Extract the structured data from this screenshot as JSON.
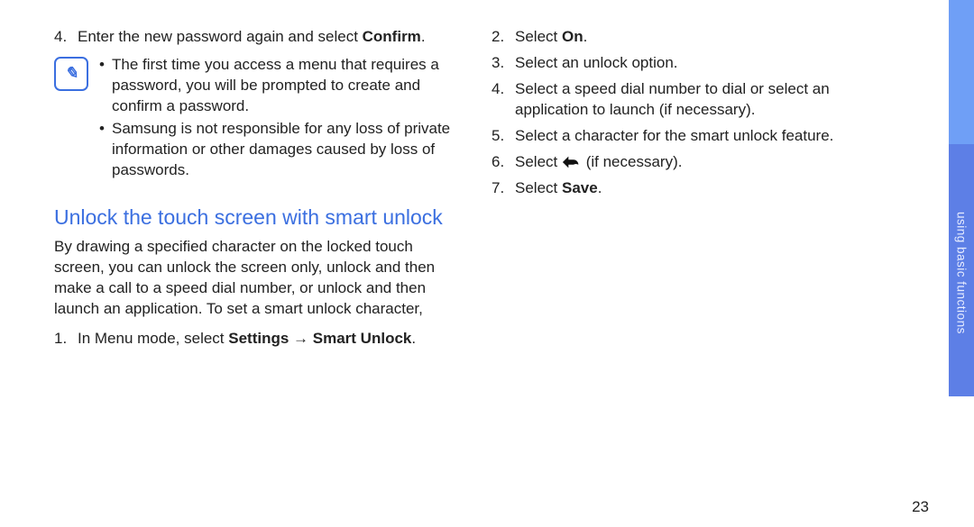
{
  "leftColumn": {
    "step4_pre": "Enter the new password again and select ",
    "step4_bold": "Confirm",
    "step4_post": ".",
    "note_icon_text": "✎",
    "note_b1": "The first time you access a menu that requires a password, you will be prompted to create and confirm a password.",
    "note_b2": "Samsung is not responsible for any loss of private information or other damages caused by loss of passwords.",
    "heading": "Unlock the touch screen with smart unlock",
    "intro": "By drawing a specified character on the locked touch screen, you can unlock the screen only, unlock and then make a call to a speed dial number, or unlock and then launch an application. To set a smart unlock character,",
    "step1_pre": "In Menu mode, select ",
    "step1_bold": "Settings → Smart Unlock",
    "step1_post": "."
  },
  "rightColumn": {
    "step2_pre": "Select ",
    "step2_bold": "On",
    "step2_post": ".",
    "step3": "Select an unlock option.",
    "step4": "Select a speed dial number to dial or select an application to launch (if necessary).",
    "step5": "Select a character for the smart unlock feature.",
    "step6_pre": "Select ",
    "step6_post": " (if necessary).",
    "step7_pre": "Select ",
    "step7_bold": "Save",
    "step7_post": "."
  },
  "sideTabLabel": "using basic functions",
  "pageNumber": "23"
}
